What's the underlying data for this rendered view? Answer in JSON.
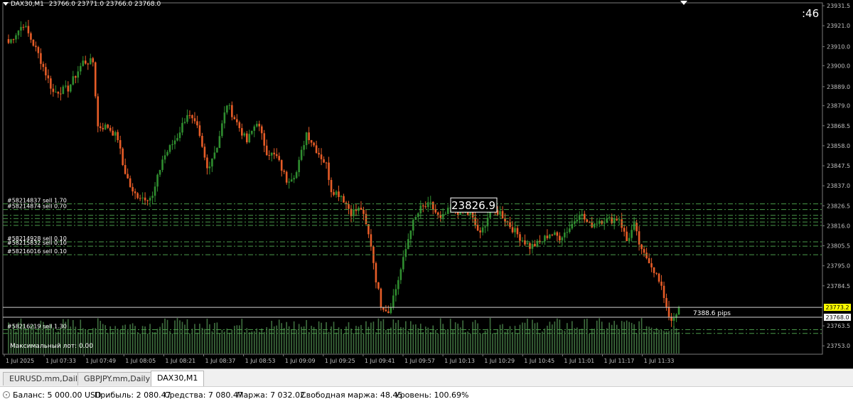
{
  "header": {
    "symbol": "DAX30,M1",
    "ohlc": "23766.0 23771.0 23766.0 23768.0",
    "timer": ":46"
  },
  "price_tag": "23826.9",
  "pips_label": "7388.6 pips",
  "bid_label": "23773.2",
  "ask_label": "23768.0",
  "max_lot": "Максимальный лот: 0.00",
  "tabs": [
    {
      "label": "EURUSD.mm,Daily",
      "active": false
    },
    {
      "label": "GBPJPY.mm,Daily",
      "active": false
    },
    {
      "label": "DAX30,M1",
      "active": true
    }
  ],
  "status": {
    "balance": "Баланс: 5 000.00 USD",
    "profit": "Прибыль: 2 080.47",
    "equity": "Средства: 7 080.47",
    "margin": "Маржа: 7 032.02",
    "free_margin": "Свободная маржа: 48.45",
    "level": "Уровень: 100.69%"
  },
  "colors": {
    "up": "#2f8d2f",
    "down": "#e65c27",
    "grid_line": "#4a9a4a",
    "volume": "#3f6f3f",
    "bid_bg": "#ffff00",
    "axis_text": "#c0c0c0"
  },
  "chart_data": {
    "type": "candlestick",
    "symbol": "DAX30",
    "timeframe": "M1",
    "ylim": [
      23748.6,
      23933.0
    ],
    "y_ticks": [
      "23931.5",
      "23921.0",
      "23910.0",
      "23900.0",
      "23889.0",
      "23879.0",
      "23868.5",
      "23858.0",
      "23847.5",
      "23837.0",
      "23826.5",
      "23816.0",
      "23805.5",
      "23795.0",
      "23784.5",
      "23763.5",
      "23753.0"
    ],
    "x_ticks": [
      "1 Jul 2025",
      "1 Jul 07:33",
      "1 Jul 07:49",
      "1 Jul 08:05",
      "1 Jul 08:21",
      "1 Jul 08:37",
      "1 Jul 08:53",
      "1 Jul 09:09",
      "1 Jul 09:25",
      "1 Jul 09:41",
      "1 Jul 09:57",
      "1 Jul 10:13",
      "1 Jul 10:29",
      "1 Jul 10:45",
      "1 Jul 11:01",
      "1 Jul 11:17",
      "1 Jul 11:33"
    ],
    "close_path": [
      [
        0,
        23912
      ],
      [
        6,
        23922
      ],
      [
        12,
        23906
      ],
      [
        18,
        23886
      ],
      [
        24,
        23888
      ],
      [
        30,
        23902
      ],
      [
        34,
        23902
      ],
      [
        36,
        23868
      ],
      [
        40,
        23868
      ],
      [
        44,
        23862
      ],
      [
        46,
        23848
      ],
      [
        50,
        23833
      ],
      [
        54,
        23831
      ],
      [
        58,
        23831
      ],
      [
        62,
        23851
      ],
      [
        68,
        23863
      ],
      [
        72,
        23875
      ],
      [
        76,
        23867
      ],
      [
        80,
        23846
      ],
      [
        84,
        23858
      ],
      [
        88,
        23880
      ],
      [
        92,
        23870
      ],
      [
        96,
        23860
      ],
      [
        100,
        23871
      ],
      [
        104,
        23855
      ],
      [
        108,
        23852
      ],
      [
        112,
        23840
      ],
      [
        116,
        23844
      ],
      [
        120,
        23865
      ],
      [
        124,
        23856
      ],
      [
        128,
        23848
      ],
      [
        130,
        23835
      ],
      [
        134,
        23832
      ],
      [
        138,
        23823
      ],
      [
        142,
        23825
      ],
      [
        144,
        23816
      ],
      [
        146,
        23806
      ],
      [
        148,
        23788
      ],
      [
        150,
        23775
      ],
      [
        153,
        23771
      ],
      [
        156,
        23783
      ],
      [
        159,
        23798
      ],
      [
        162,
        23815
      ],
      [
        166,
        23825
      ],
      [
        170,
        23827
      ],
      [
        174,
        23819
      ],
      [
        178,
        23825
      ],
      [
        182,
        23823
      ],
      [
        186,
        23822
      ],
      [
        190,
        23811
      ],
      [
        194,
        23824
      ],
      [
        198,
        23823
      ],
      [
        202,
        23816
      ],
      [
        206,
        23810
      ],
      [
        210,
        23805
      ],
      [
        214,
        23807
      ],
      [
        218,
        23812
      ],
      [
        222,
        23810
      ],
      [
        226,
        23815
      ],
      [
        230,
        23823
      ],
      [
        234,
        23816
      ],
      [
        238,
        23819
      ],
      [
        242,
        23819
      ],
      [
        246,
        23820
      ],
      [
        249,
        23808
      ],
      [
        252,
        23816
      ],
      [
        255,
        23802
      ],
      [
        258,
        23798
      ],
      [
        261,
        23790
      ],
      [
        264,
        23779
      ],
      [
        266,
        23769
      ],
      [
        268,
        23766
      ],
      [
        270,
        23772
      ]
    ],
    "sell_orders": [
      {
        "label": "#58214837 sell 1.70",
        "price": 23827.5
      },
      {
        "label": "#58214874 sell 0.70",
        "price": 23824.5
      },
      {
        "label": "",
        "price": 23821.5
      },
      {
        "label": "",
        "price": 23819.8
      },
      {
        "label": "",
        "price": 23818.0
      },
      {
        "label": "",
        "price": 23816.2
      },
      {
        "label": "#58214928 sell 0.10",
        "price": 23807.6
      },
      {
        "label": "#58215832 sell 0.10",
        "price": 23805.3
      },
      {
        "label": "#58216016 sell 0.10",
        "price": 23800.8
      },
      {
        "label": "#58216219 sell 1.30",
        "price": 23761.5
      },
      {
        "label": "",
        "price": 23759.5
      }
    ],
    "hlines": [
      {
        "kind": "bid",
        "price": 23773.2
      },
      {
        "kind": "ask",
        "price": 23768.0
      }
    ],
    "grid": false
  }
}
